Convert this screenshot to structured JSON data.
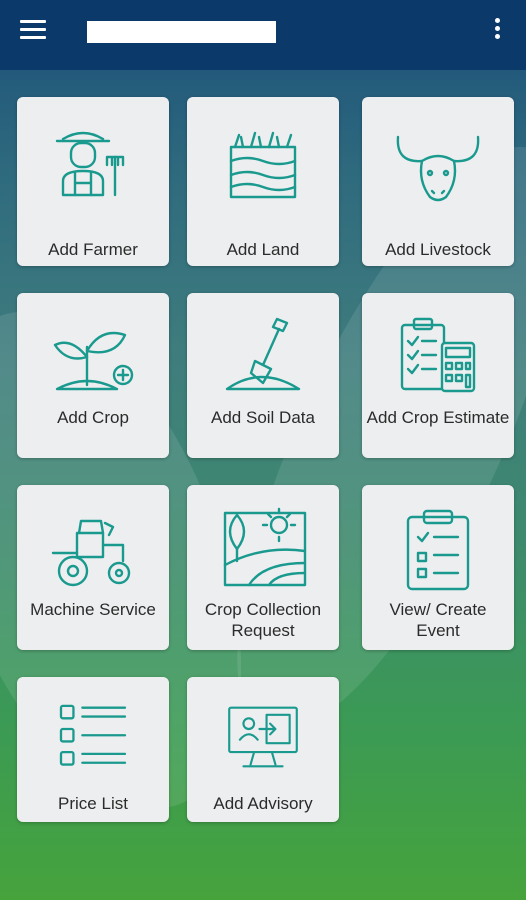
{
  "appbar": {
    "menu_icon": "hamburger-menu-icon",
    "title": "",
    "more_icon": "more-vertical-icon",
    "background": "#0b3a6a"
  },
  "theme": {
    "icon_color": "#1a9a8e",
    "tile_bg": "#edeef0"
  },
  "tiles": [
    {
      "label": "Add Farmer",
      "icon": "farmer-icon"
    },
    {
      "label": "Add Land",
      "icon": "land-icon"
    },
    {
      "label": "Add Livestock",
      "icon": "livestock-icon"
    },
    {
      "label": "Add Crop",
      "icon": "crop-icon"
    },
    {
      "label": "Add Soil Data",
      "icon": "soil-data-icon"
    },
    {
      "label": "Add Crop Estimate",
      "icon": "crop-estimate-icon"
    },
    {
      "label": "Machine Service",
      "icon": "tractor-icon"
    },
    {
      "label": "Crop Collection Request",
      "icon": "crop-collection-icon"
    },
    {
      "label": "View/ Create Event",
      "icon": "event-clipboard-icon"
    },
    {
      "label": "Price List",
      "icon": "price-list-icon"
    },
    {
      "label": "Add Advisory",
      "icon": "advisory-icon"
    }
  ]
}
